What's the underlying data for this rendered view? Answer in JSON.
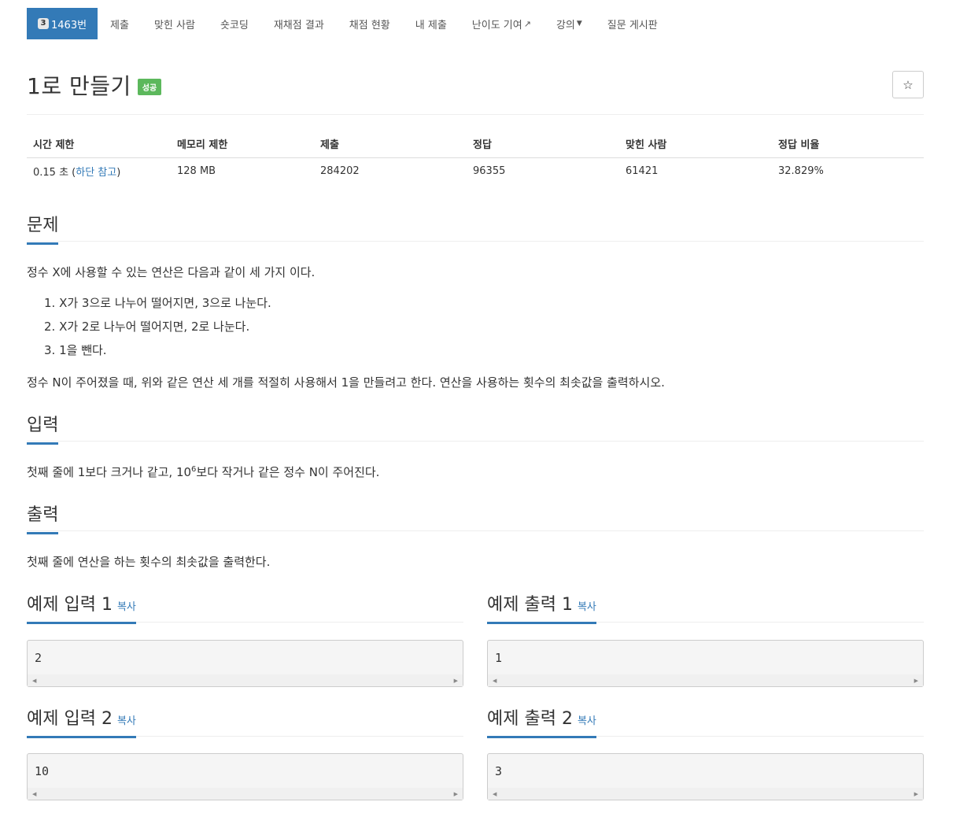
{
  "nav": {
    "problem_id": "1463번",
    "tier": "3",
    "items": [
      {
        "label": "제출"
      },
      {
        "label": "맞힌 사람"
      },
      {
        "label": "숏코딩"
      },
      {
        "label": "재채점 결과"
      },
      {
        "label": "채점 현황"
      },
      {
        "label": "내 제출"
      },
      {
        "label": "난이도 기여",
        "icon": "external-link-icon"
      },
      {
        "label": "강의",
        "icon": "caret-down-icon"
      },
      {
        "label": "질문 게시판"
      }
    ]
  },
  "problem": {
    "title": "1로 만들기",
    "result": "성공",
    "star_icon": "☆"
  },
  "info_table": {
    "headers": [
      "시간 제한",
      "메모리 제한",
      "제출",
      "정답",
      "맞힌 사람",
      "정답 비율"
    ],
    "time_limit": "0.15 초 (",
    "time_limit_link": "하단 참고",
    "time_limit_close": ")",
    "memory_limit": "128 MB",
    "submissions": "284202",
    "accepted": "96355",
    "solvers": "61421",
    "ratio": "32.829%"
  },
  "description": {
    "heading": "문제",
    "intro": "정수 X에 사용할 수 있는 연산은 다음과 같이 세 가지 이다.",
    "operations": [
      "1. X가 3으로 나누어 떨어지면, 3으로 나눈다.",
      "2. X가 2로 나누어 떨어지면, 2로 나눈다.",
      "3. 1을 뺀다."
    ],
    "task": "정수 N이 주어졌을 때, 위와 같은 연산 세 개를 적절히 사용해서 1을 만들려고 한다. 연산을 사용하는 횟수의 최솟값을 출력하시오."
  },
  "input": {
    "heading": "입력",
    "text_before": "첫째 줄에 1보다 크거나 같고, 10",
    "sup": "6",
    "text_after": "보다 작거나 같은 정수 N이 주어진다."
  },
  "output": {
    "heading": "출력",
    "text": "첫째 줄에 연산을 하는 횟수의 최솟값을 출력한다."
  },
  "samples": {
    "copy_label": "복사",
    "input1_title": "예제 입력 1",
    "input1_value": "2",
    "output1_title": "예제 출력 1",
    "output1_value": "1",
    "input2_title": "예제 입력 2",
    "input2_value": "10",
    "output2_title": "예제 출력 2",
    "output2_value": "3"
  }
}
